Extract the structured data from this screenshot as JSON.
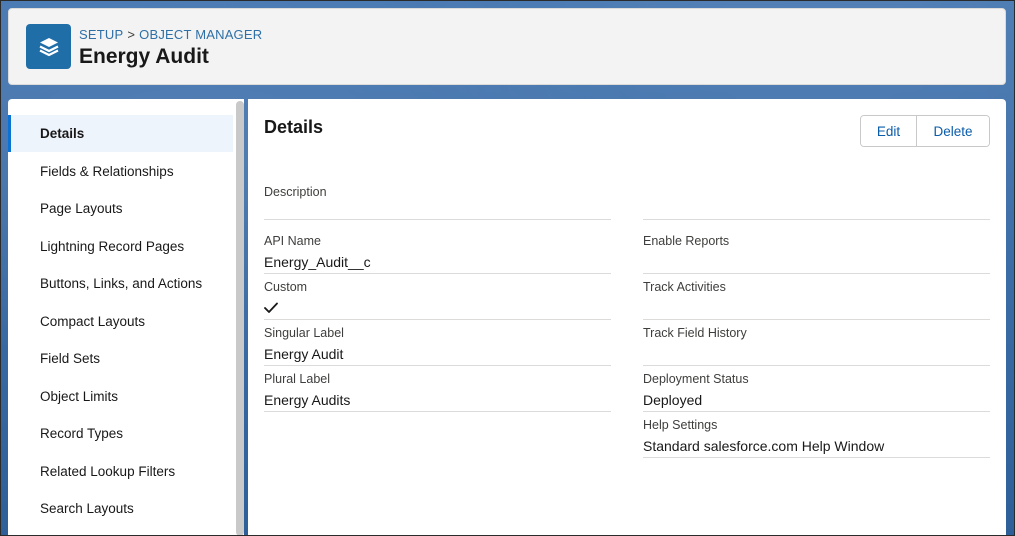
{
  "header": {
    "breadcrumb": [
      "SETUP",
      "OBJECT MANAGER"
    ],
    "breadcrumb_sep": ">",
    "title": "Energy Audit",
    "icon": "layers-icon"
  },
  "sidebar": {
    "items": [
      {
        "label": "Details",
        "active": true
      },
      {
        "label": "Fields & Relationships"
      },
      {
        "label": "Page Layouts"
      },
      {
        "label": "Lightning Record Pages"
      },
      {
        "label": "Buttons, Links, and Actions"
      },
      {
        "label": "Compact Layouts"
      },
      {
        "label": "Field Sets"
      },
      {
        "label": "Object Limits"
      },
      {
        "label": "Record Types"
      },
      {
        "label": "Related Lookup Filters"
      },
      {
        "label": "Search Layouts"
      }
    ]
  },
  "main": {
    "title": "Details",
    "buttons": {
      "edit": "Edit",
      "delete": "Delete"
    },
    "description_label": "Description",
    "left_fields": [
      {
        "label": "API Name",
        "value": "Energy_Audit__c"
      },
      {
        "label": "Custom",
        "value": "",
        "checked": true
      },
      {
        "label": "Singular Label",
        "value": "Energy Audit"
      },
      {
        "label": "Plural Label",
        "value": "Energy Audits"
      }
    ],
    "right_fields": [
      {
        "label": "Enable Reports",
        "value": ""
      },
      {
        "label": "Track Activities",
        "value": ""
      },
      {
        "label": "Track Field History",
        "value": ""
      },
      {
        "label": "Deployment Status",
        "value": "Deployed"
      },
      {
        "label": "Help Settings",
        "value": "Standard salesforce.com Help Window"
      }
    ]
  },
  "colors": {
    "accent": "#0b72d4",
    "link": "#2e6fa6",
    "icon_bg": "#1f6ea8"
  }
}
